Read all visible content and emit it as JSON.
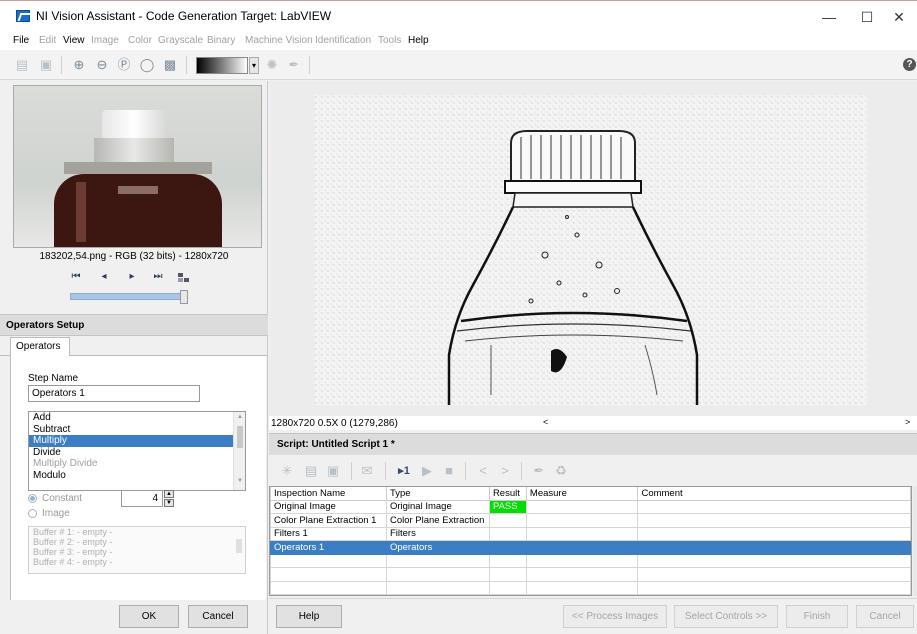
{
  "window": {
    "title": "NI Vision Assistant - Code Generation Target: LabVIEW",
    "minimize": "—",
    "maximize": "☐",
    "close": "✕"
  },
  "menu": {
    "items": [
      {
        "label": "File",
        "enabled": true
      },
      {
        "label": "Edit",
        "enabled": false
      },
      {
        "label": "View",
        "enabled": true
      },
      {
        "label": "Image",
        "enabled": false
      },
      {
        "label": "Color",
        "enabled": false
      },
      {
        "label": "Grayscale",
        "enabled": false
      },
      {
        "label": "Binary",
        "enabled": false
      },
      {
        "label": "Machine Vision",
        "enabled": false
      },
      {
        "label": "Identification",
        "enabled": false
      },
      {
        "label": "Tools",
        "enabled": false
      },
      {
        "label": "Help",
        "enabled": true
      }
    ]
  },
  "toolbar": {
    "open_icon": "folder-icon",
    "save_icon": "save-icon",
    "zoom_in_icon": "zoom-in-icon",
    "zoom_out_icon": "zoom-out-icon",
    "zoom_1to1_icon": "zoom-actual-icon",
    "zoom_fit_icon": "zoom-fit-icon",
    "view_icon": "image-view-icon",
    "palette_dropdown": "▾",
    "help": "?"
  },
  "browser": {
    "caption": "183202,54.png - RGB (32 bits) - 1280x720",
    "nav_first": "⏮",
    "nav_prev": "◂",
    "nav_next": "▸",
    "nav_last": "⏭",
    "slider_value": 0.95
  },
  "operators_setup": {
    "title": "Operators Setup",
    "tab": "Operators",
    "step_name_label": "Step Name",
    "step_name_value": "Operators 1",
    "operations": [
      {
        "label": "Add",
        "state": "normal"
      },
      {
        "label": "Subtract",
        "state": "normal"
      },
      {
        "label": "Multiply",
        "state": "selected"
      },
      {
        "label": "Divide",
        "state": "normal"
      },
      {
        "label": "Multiply Divide",
        "state": "disabled"
      },
      {
        "label": "Modulo",
        "state": "normal"
      }
    ],
    "constant_label": "Constant",
    "image_label": "Image",
    "constant_value": "4",
    "buffers": [
      "Buffer # 1:   - empty -",
      "Buffer # 2:   - empty -",
      "Buffer # 3:   - empty -",
      "Buffer # 4:   - empty -"
    ],
    "ok": "OK",
    "cancel": "Cancel"
  },
  "viewer": {
    "status": "1280x720 0.5X 0   (1279,286)",
    "scroll_left": "<",
    "scroll_right": ">"
  },
  "script": {
    "title": "Script: Untitled Script 1 *",
    "columns": [
      "Inspection Name",
      "Type",
      "Result",
      "Measure",
      "Comment"
    ],
    "rows": [
      {
        "name": "Original Image",
        "type": "Original Image",
        "result": "PASS",
        "measure": "",
        "comment": ""
      },
      {
        "name": "Color Plane Extraction 1",
        "type": "Color Plane Extraction",
        "result": "",
        "measure": "",
        "comment": ""
      },
      {
        "name": "Filters 1",
        "type": "Filters",
        "result": "",
        "measure": "",
        "comment": ""
      },
      {
        "name": "Operators 1",
        "type": "Operators",
        "result": "",
        "measure": "",
        "comment": ""
      }
    ],
    "run_once_label": "▸1"
  },
  "bottom": {
    "help": "Help",
    "process_images": "<< Process Images",
    "select_controls": "Select Controls >>",
    "finish": "Finish",
    "cancel": "Cancel"
  },
  "colors": {
    "selection": "#3b7ec4",
    "pass": "#00e000"
  }
}
